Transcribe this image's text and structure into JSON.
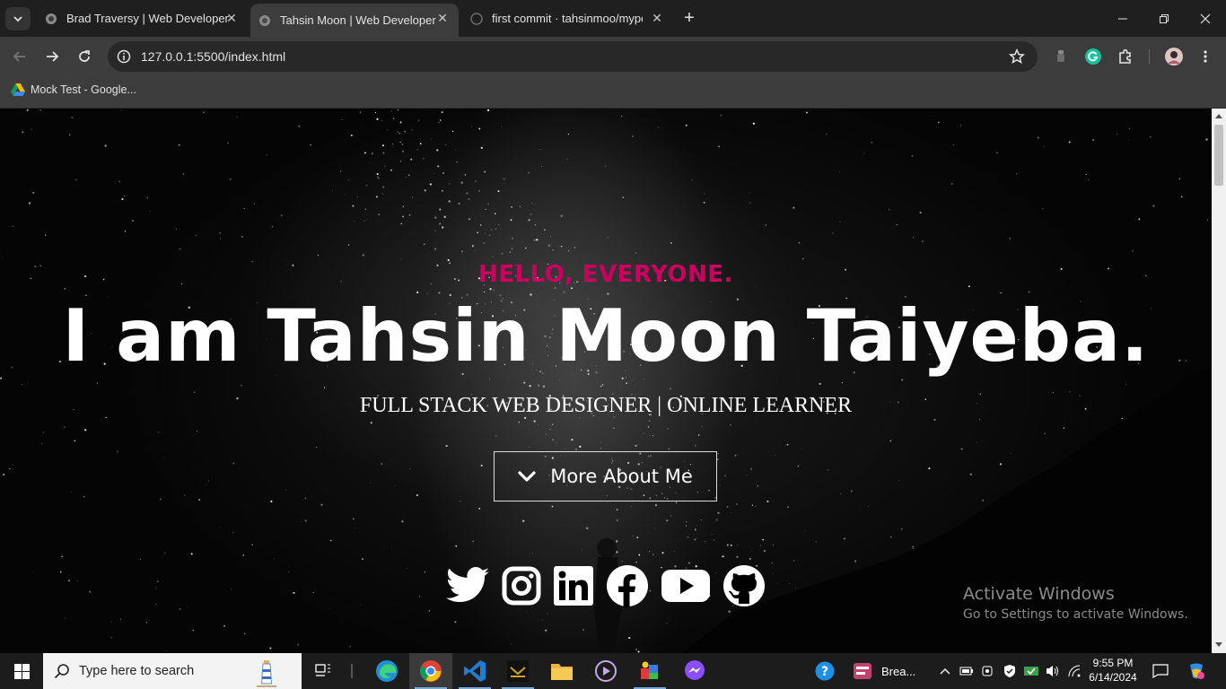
{
  "browser": {
    "tabs": [
      {
        "title": "Brad Traversy | Web Developer",
        "active": false
      },
      {
        "title": "Tahsin Moon | Web Developer",
        "active": true
      },
      {
        "title": "first commit · tahsinmoo/mypor",
        "active": false
      }
    ],
    "url": "127.0.0.1:5500/index.html",
    "bookmarks": [
      {
        "label": "Mock Test - Google..."
      }
    ]
  },
  "hero": {
    "greeting": "HELLO, EVERYONE.",
    "name": "I am Tahsin Moon Taiyeba.",
    "tagline": "FULL STACK WEB DESIGNER | ONLINE LEARNER",
    "button_label": "More About Me",
    "socials": [
      "twitter-icon",
      "instagram-icon",
      "linkedin-icon",
      "facebook-icon",
      "youtube-icon",
      "github-icon"
    ],
    "accent": "#cc005f"
  },
  "watermark": {
    "line1": "Activate Windows",
    "line2": "Go to Settings to activate Windows."
  },
  "taskbar": {
    "search_placeholder": "Type here to search",
    "tray_app_label": "Brea...",
    "time": "9:55 PM",
    "date": "6/14/2024"
  }
}
